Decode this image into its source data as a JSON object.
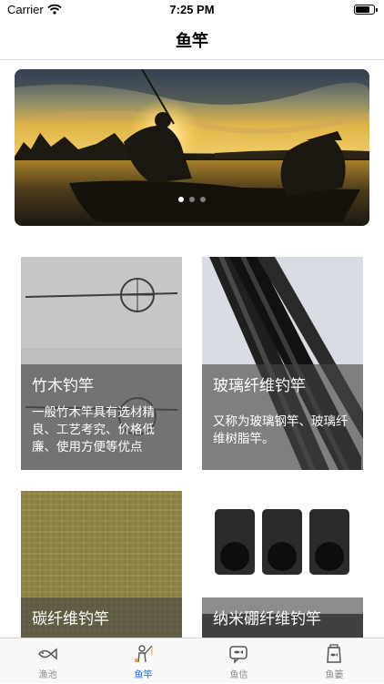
{
  "status": {
    "carrier": "Carrier",
    "time": "7:25 PM",
    "battery_level": 0.8
  },
  "nav": {
    "title": "鱼竿"
  },
  "banner": {
    "page_count": 3,
    "active_page": 1
  },
  "cards": [
    {
      "title": "竹木钓竿",
      "description": "一般竹木竿具有选材精良、工艺考究、价格低廉、使用方便等优点"
    },
    {
      "title": "玻璃纤维钓竿",
      "description": "又称为玻璃钢竿、玻璃纤维树脂竿。"
    },
    {
      "title": "碳纤维钓竿",
      "description": ""
    },
    {
      "title": "纳米硼纤维钓竿",
      "description": ""
    }
  ],
  "tabs": [
    {
      "label": "渔池",
      "icon": "fish-icon"
    },
    {
      "label": "鱼竿",
      "icon": "angler-icon"
    },
    {
      "label": "鱼信",
      "icon": "message-icon"
    },
    {
      "label": "鱼篓",
      "icon": "fish-basket-icon"
    }
  ],
  "active_tab": 1,
  "colors": {
    "active_tab": "#1a73e8",
    "inactive_tab": "#8a8a8a"
  }
}
